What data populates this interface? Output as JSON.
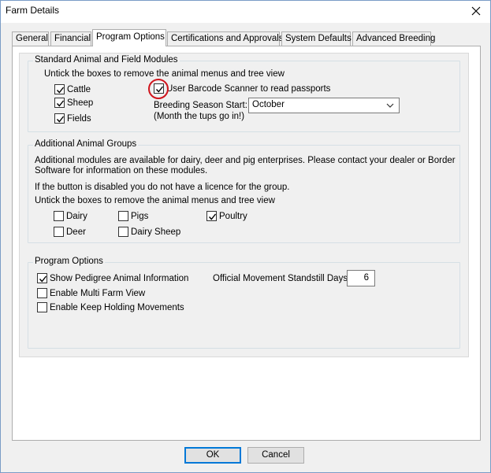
{
  "window": {
    "title": "Farm Details"
  },
  "tabs": [
    "General",
    "Financial",
    "Program Options",
    "Certifications and Approvals",
    "System Defaults",
    "Advanced Breeding"
  ],
  "standard": {
    "title": "Standard Animal and Field Modules",
    "hint": "Untick the boxes to remove the animal menus and tree view",
    "cattle": "Cattle",
    "sheep": "Sheep",
    "fields": "Fields",
    "barcode": "User Barcode Scanner to read passports",
    "breeding_label": "Breeding Season Start:",
    "breeding_value": "October",
    "breeding_note": "(Month the tups go in!)"
  },
  "additional": {
    "title": "Additional Animal Groups",
    "info1": "Additional modules are available for dairy, deer and pig enterprises. Please contact your dealer or Border",
    "info2": "Software for information on these modules.",
    "licence": "If the button is disabled you do not have a licence for the group.",
    "hint": "Untick the boxes to remove the animal menus and tree view",
    "dairy": "Dairy",
    "pigs": "Pigs",
    "poultry": "Poultry",
    "deer": "Deer",
    "dairy_sheep": "Dairy Sheep"
  },
  "program": {
    "title": "Program Options",
    "pedigree": "Show Pedigree Animal Information",
    "multi_farm": "Enable Multi Farm View",
    "keep_holding": "Enable Keep Holding Movements",
    "standstill_label": "Official Movement Standstill Days:",
    "standstill_value": "6"
  },
  "buttons": {
    "ok": "OK",
    "cancel": "Cancel"
  },
  "colors": {
    "highlight_circle": "#d0141c",
    "default_button_border": "#0078d7"
  }
}
